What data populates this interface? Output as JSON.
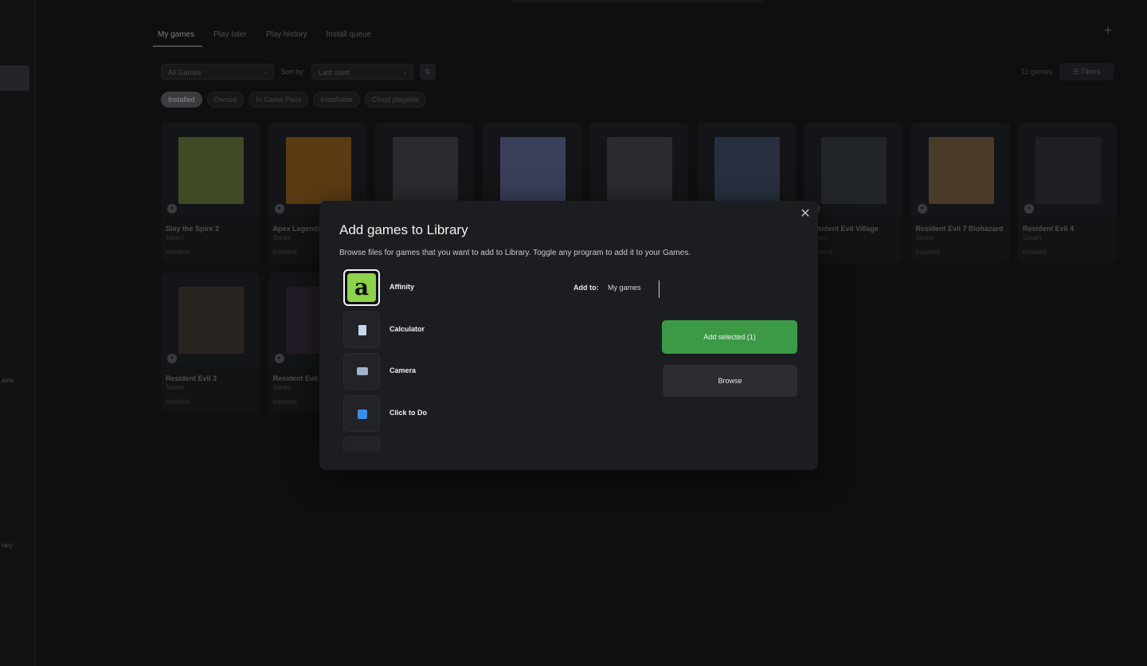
{
  "background": {
    "tabs": [
      "My games",
      "Play later",
      "Play history",
      "Install queue"
    ],
    "filter": {
      "collection": "All Games",
      "sort_label": "Sort by:",
      "sort_value": "Last used",
      "order_icon": "sort-order-icon"
    },
    "count": "11 games",
    "filters_button": "Filters",
    "chips": [
      "Installed",
      "Owned",
      "In Game Pass",
      "Installable",
      "Cloud playable"
    ],
    "sidebar_fragments": [
      "ains",
      "rary"
    ],
    "games": [
      {
        "title": "Slay the Spire 2",
        "platform": "Steam",
        "status": "Installed",
        "color": "#3f4b24"
      },
      {
        "title": "Apex Legends",
        "platform": "Steam",
        "status": "Installed",
        "color": "#5b3b14"
      },
      {
        "title": "",
        "platform": "",
        "status": "",
        "color": "#2a2b2e"
      },
      {
        "title": "",
        "platform": "",
        "status": "",
        "color": "#3a3f5a"
      },
      {
        "title": "",
        "platform": "",
        "status": "",
        "color": "#2a2b2e"
      },
      {
        "title": "",
        "platform": "",
        "status": "",
        "color": "#283040"
      },
      {
        "title": "Resident Evil Village",
        "platform": "Steam",
        "status": "Installed",
        "color": "#22262b"
      },
      {
        "title": "Resident Evil 7 Biohazard",
        "platform": "Steam",
        "status": "Installed",
        "color": "#4a3a2a"
      },
      {
        "title": "Resident Evil 4",
        "platform": "Steam",
        "status": "Installed",
        "color": "#1e1f22"
      },
      {
        "title": "Resident Evil 3",
        "platform": "Steam",
        "status": "Installed",
        "color": "#2a2420"
      },
      {
        "title": "Resident Evil",
        "platform": "Steam",
        "status": "Installed",
        "color": "#221c26"
      }
    ]
  },
  "modal": {
    "title": "Add games to Library",
    "description": "Browse files for games that you want to add to Library. Toggle any program to add it to your Games.",
    "close_icon": "close-icon",
    "programs": [
      {
        "name": "Affinity",
        "icon": "affinity-icon",
        "selected": true
      },
      {
        "name": "Calculator",
        "icon": "calculator-icon",
        "selected": false
      },
      {
        "name": "Camera",
        "icon": "camera-icon",
        "selected": false
      },
      {
        "name": "Click to Do",
        "icon": "click-to-do-icon",
        "selected": false
      },
      {
        "name": "",
        "icon": "app-icon",
        "selected": false
      }
    ],
    "add_to_label": "Add to:",
    "add_to_value": "My games",
    "add_selected_button": "Add selected (1)",
    "browse_button": "Browse",
    "accent_color": "#3c9a46"
  }
}
